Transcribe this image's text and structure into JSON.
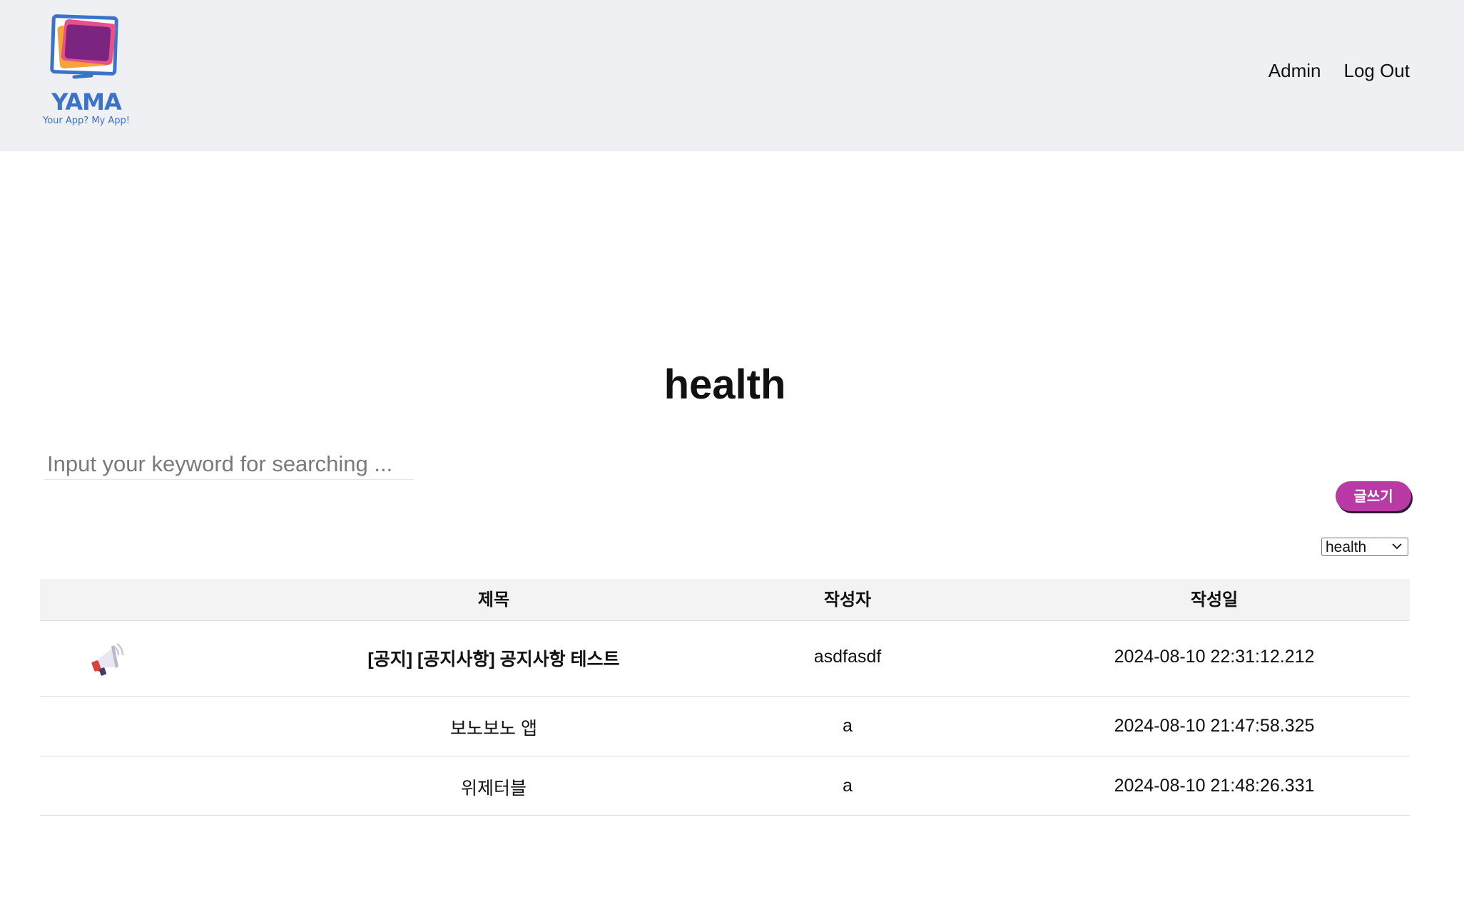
{
  "header": {
    "logo_name": "YAMA",
    "logo_tagline": "Your App? My App!",
    "nav": [
      "Admin",
      "Log Out"
    ]
  },
  "page_title": "health",
  "search": {
    "placeholder": "Input your keyword for searching ...",
    "value": ""
  },
  "write_button_label": "글쓰기",
  "category_select": {
    "selected": "health"
  },
  "table": {
    "headers": [
      "제목",
      "작성자",
      "작성일"
    ],
    "rows": [
      {
        "icon": "megaphone-icon",
        "title": "[공지] [공지사항] 공지사항 테스트",
        "author": "asdfasdf",
        "date": "2024-08-10 22:31:12.212",
        "notice": true
      },
      {
        "icon": "",
        "title": "보노보노 앱",
        "author": "a",
        "date": "2024-08-10 21:47:58.325",
        "notice": false
      },
      {
        "icon": "",
        "title": "위제터블",
        "author": "a",
        "date": "2024-08-10 21:48:26.331",
        "notice": false
      }
    ]
  },
  "colors": {
    "header_bg": "#eff0f3",
    "brand_blue": "#3a73c9",
    "write_button": "#b93aa5"
  }
}
